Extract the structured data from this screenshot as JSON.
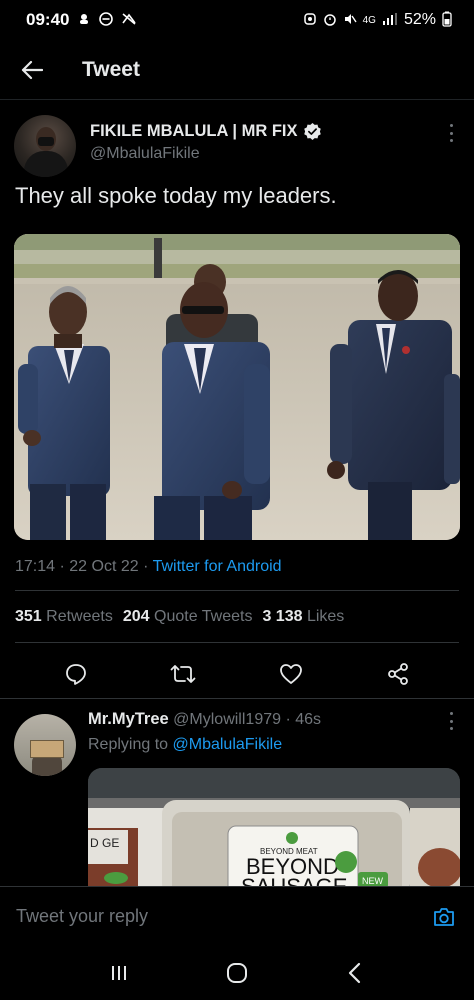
{
  "status_bar": {
    "time": "09:40",
    "left_icons": [
      "notification-icon",
      "do-not-disturb-icon",
      "no-photo-icon"
    ],
    "right_icons": [
      "alarm-icon",
      "mute-icon",
      "data-icon",
      "signal-icon"
    ],
    "network": "4G",
    "battery": "52%"
  },
  "header": {
    "title": "Tweet"
  },
  "tweet": {
    "display_name": "FIKILE MBALULA | MR FIX",
    "handle": "@MbalulaFikile",
    "text": "They all spoke today my leaders.",
    "time": "17:14",
    "date": "22 Oct 22",
    "source": "Twitter for Android",
    "stats": {
      "retweets_count": "351",
      "retweets_label": "Retweets",
      "quotes_count": "204",
      "quotes_label": "Quote Tweets",
      "likes_count": "3 138",
      "likes_label": "Likes"
    }
  },
  "reply": {
    "display_name": "Mr.MyTree",
    "handle": "@Mylowill1979",
    "age": "46s",
    "replying_prefix": "Replying to",
    "replying_to": "@MbalulaFikile",
    "media_texts": {
      "brand": "BEYOND MEAT",
      "product_line1": "BEYOND",
      "product_line2": "SAUSAGE",
      "badge": "NEW",
      "partial_left": "D GE"
    }
  },
  "compose": {
    "placeholder": "Tweet your reply"
  },
  "colors": {
    "background": "#000000",
    "text_primary": "#e7e9ea",
    "text_secondary": "#71767b",
    "accent": "#1d9bf0"
  }
}
